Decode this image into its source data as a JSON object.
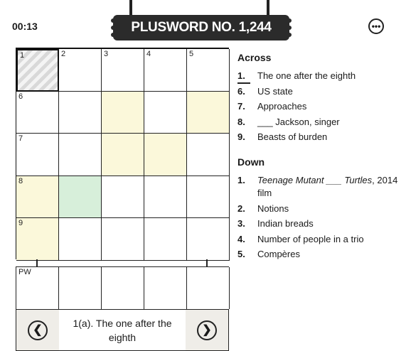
{
  "timer": "00:13",
  "title": "PLUSWORD NO. 1,244",
  "menu_icon": "ellipsis-icon",
  "grid": {
    "numbers": [
      "1",
      "2",
      "3",
      "4",
      "5",
      "6",
      "7",
      "8",
      "9"
    ],
    "pw_label": "PW"
  },
  "current_clue": "1(a). The one after the eighth",
  "across": {
    "heading": "Across",
    "items": [
      {
        "num": "1.",
        "text": "The one after the eighth"
      },
      {
        "num": "6.",
        "text": "US state"
      },
      {
        "num": "7.",
        "text": "Approaches"
      },
      {
        "num": "8.",
        "text": "___ Jackson, singer"
      },
      {
        "num": "9.",
        "text": "Beasts of burden"
      }
    ]
  },
  "down": {
    "heading": "Down",
    "items": [
      {
        "num": "1.",
        "text_italic": "Teenage Mutant ___ Turtles",
        "text_rest": ", 2014 film"
      },
      {
        "num": "2.",
        "text": "Notions"
      },
      {
        "num": "3.",
        "text": "Indian breads"
      },
      {
        "num": "4.",
        "text": "Number of people in a trio"
      },
      {
        "num": "5.",
        "text": "Compères"
      }
    ]
  },
  "colors": {
    "highlight_yellow": "#fbf8da",
    "highlight_green": "#d7efda",
    "sign": "#2b2b2b"
  }
}
